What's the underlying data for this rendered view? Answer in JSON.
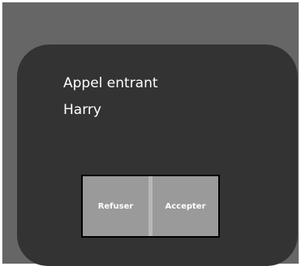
{
  "dialog": {
    "title": "Appel entrant",
    "caller": "Harry"
  },
  "actions": {
    "reject_label": "Refuser",
    "accept_label": "Accepter"
  },
  "colors": {
    "screen_bg": "#666666",
    "dialog_bg": "#333333",
    "button_bg": "#9a9a9a",
    "button_border": "#000000",
    "divider": "#b7b7b7",
    "text": "#ffffff"
  }
}
